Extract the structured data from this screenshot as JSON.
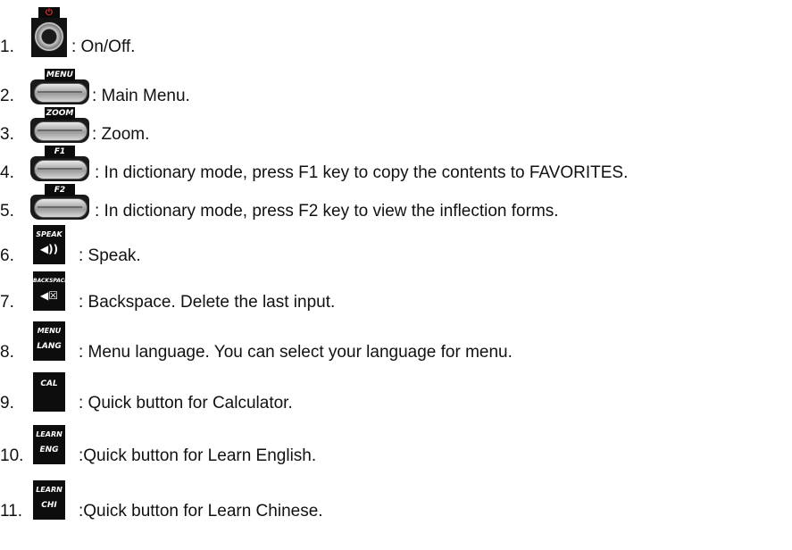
{
  "items": [
    {
      "num": "1.",
      "icon": "power-button-icon",
      "icon_text": "⏻",
      "desc": ": On/Off."
    },
    {
      "num": "2.",
      "icon": "menu-key-icon",
      "icon_text": "MENU",
      "desc": ": Main Menu."
    },
    {
      "num": "3.",
      "icon": "zoom-key-icon",
      "icon_text": "ZOOM",
      "desc": ": Zoom."
    },
    {
      "num": "4.",
      "icon": "f1-key-icon",
      "icon_text": "F1",
      "desc": ": In dictionary mode, press F1 key to copy the contents to FAVORITES."
    },
    {
      "num": "5.",
      "icon": "f2-key-icon",
      "icon_text": "F2",
      "desc": ": In dictionary mode, press F2 key to view the inflection forms."
    },
    {
      "num": "6.",
      "icon": "speak-key-icon",
      "icon_text": "SPEAK",
      "icon_glyph": "◀))",
      "desc": ": Speak."
    },
    {
      "num": "7.",
      "icon": "backspace-key-icon",
      "icon_text": "BACKSPACE",
      "icon_glyph": "◀☒",
      "desc": ": Backspace. Delete the last input."
    },
    {
      "num": "8.",
      "icon": "menu-lang-key-icon",
      "icon_text": "MENU",
      "icon_text2": "LANG",
      "desc": ": Menu language. You can select your language for menu."
    },
    {
      "num": "9.",
      "icon": "cal-key-icon",
      "icon_text": "CAL",
      "desc": ": Quick button for Calculator."
    },
    {
      "num": "10.",
      "icon": "learn-eng-key-icon",
      "icon_text": "LEARN",
      "icon_text2": "ENG",
      "desc": ":Quick button for Learn English."
    },
    {
      "num": "11.",
      "icon": "learn-chi-key-icon",
      "icon_text": "LEARN",
      "icon_text2": "CHI",
      "desc": ":Quick button for Learn Chinese."
    }
  ],
  "colors": {
    "text": "#111111",
    "key_black": "#0d0d0d",
    "power_red": "#e0302a"
  }
}
